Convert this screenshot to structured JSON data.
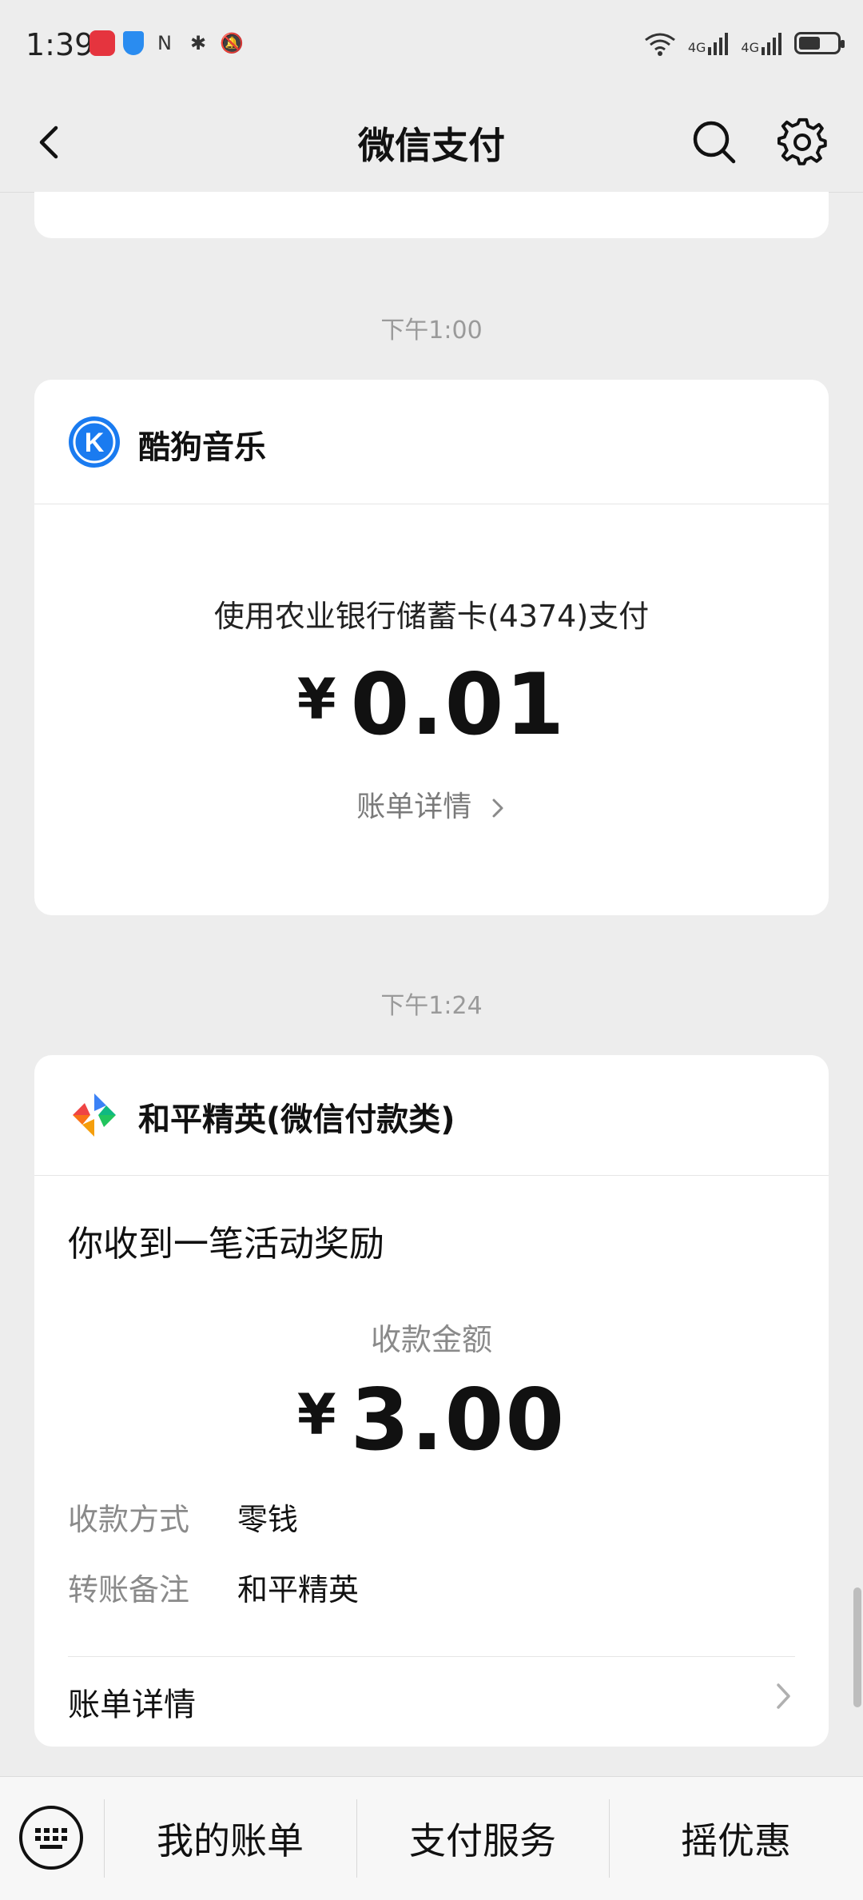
{
  "status_bar": {
    "time": "1:39",
    "network_labels": [
      "4G",
      "4G"
    ]
  },
  "nav": {
    "title": "微信支付"
  },
  "messages": [
    {
      "time": "下午1:00",
      "merchant": "酷狗音乐",
      "logo_letter": "K",
      "pay_method_text": "使用农业银行储蓄卡(4374)支付",
      "currency": "¥",
      "amount": "0.01",
      "detail_link": "账单详情"
    },
    {
      "time": "下午1:24",
      "merchant": "和平精英(微信付款类)",
      "title": "你收到一笔活动奖励",
      "amount_label": "收款金额",
      "currency": "¥",
      "amount": "3.00",
      "fields": [
        {
          "key": "收款方式",
          "value": "零钱"
        },
        {
          "key": "转账备注",
          "value": "和平精英"
        }
      ],
      "detail_link": "账单详情"
    }
  ],
  "bottom_menu": {
    "items": [
      "我的账单",
      "支付服务",
      "摇优惠"
    ]
  },
  "colors": {
    "background": "#ededed",
    "card": "#ffffff",
    "kugou_blue": "#1a7bf0"
  }
}
